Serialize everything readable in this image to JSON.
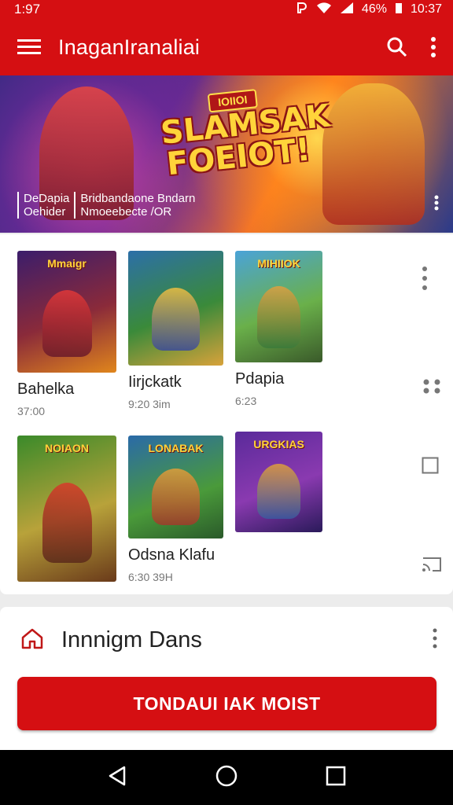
{
  "status": {
    "time": "1:97",
    "battery": "46%",
    "clock": "10:37"
  },
  "appbar": {
    "title": "InaganIranaliai"
  },
  "banner": {
    "tag": "IOIIOI",
    "headline": "SLAMSAK FOEIOT!",
    "caption_left_1": "DeDapia",
    "caption_left_2": "Oehider",
    "caption_right_1": "Bridbandaone Bndarn",
    "caption_right_2": "Nmoeebecte /OR"
  },
  "grid": {
    "items": [
      {
        "title": "Bahelka",
        "meta": "37:00",
        "cover_title": "Mmaigr"
      },
      {
        "title": "Iirjckatk",
        "meta": "9:20   3im",
        "cover_title": ""
      },
      {
        "title": "Pdapia",
        "meta": "6:23",
        "cover_title": "MIHIIOK"
      },
      {
        "title": "",
        "meta": "",
        "cover_title": "NOIAON"
      },
      {
        "title": "Odsna Klafu",
        "meta": "6:30   39H",
        "cover_title": "LONABAK"
      },
      {
        "title": "",
        "meta": "",
        "cover_title": "URGKIAS"
      }
    ]
  },
  "section": {
    "label": "Innnigm Dans",
    "cta": "TONDAUI IAK MOIST"
  },
  "colors": {
    "primary": "#d50f12"
  }
}
